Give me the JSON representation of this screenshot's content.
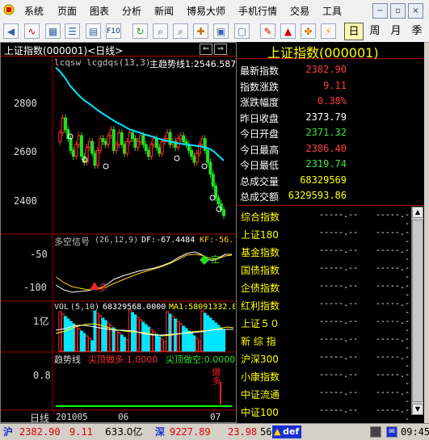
{
  "menu": {
    "items": [
      "系统",
      "页面",
      "图表",
      "分析",
      "新闻",
      "博易大师",
      "手机行情",
      "交易",
      "工具"
    ],
    "window_buttons": [
      "−",
      "▫",
      "×"
    ]
  },
  "toolbar": {
    "periods": [
      "日",
      "周",
      "月",
      "季"
    ],
    "active_period": "日"
  },
  "chart": {
    "title": "上证指数(000001)<日线>",
    "nav_arrows": [
      "⇐",
      "⇒"
    ],
    "main_indicator": {
      "label1": "lcqsw",
      "label2": "lcgdqs(13,3)",
      "label3": "主趋势线1:2546.587"
    },
    "y_ticks_main": [
      "2800",
      "2600",
      "2400"
    ],
    "macd": {
      "title": "多空信号",
      "params": "(26,12,9)",
      "df": "DF:-67.4484",
      "kf": "KF:-56.1",
      "y_ticks": [
        "-50",
        "-100"
      ],
      "buy_signal": "多",
      "sell_signal": "空"
    },
    "vol": {
      "title": "VOL",
      "params": "(5,10)",
      "value": "68329568.0000",
      "ma1": "MA1:58091332.8",
      "y_tick": "1亿"
    },
    "trend": {
      "title": "趋势线",
      "top_more": "尖顶做多:1.0000",
      "top_short": "尖顶做空:0.0000",
      "y_tick": "0.8",
      "signal": "做多"
    },
    "x_axis": {
      "period_label": "日线",
      "ticks": [
        "201005",
        "06",
        "07"
      ]
    },
    "chart_data": {
      "type": "candlestick",
      "title": "上证指数(000001)<日线>",
      "ylim": [
        2300,
        2900
      ],
      "y_ticks": [
        2800,
        2600,
        2400
      ],
      "x_ticks": [
        "201005",
        "06",
        "07"
      ],
      "trend_line_name": "主趋势线1",
      "trend_line_last": 2546.587,
      "trend_line": [
        2860,
        2845,
        2825,
        2800,
        2782,
        2765,
        2750,
        2740,
        2728,
        2716,
        2705,
        2695,
        2685,
        2675,
        2667,
        2658,
        2650,
        2645,
        2640,
        2634,
        2630,
        2625,
        2620,
        2615,
        2612,
        2608,
        2605,
        2602,
        2600,
        2598,
        2596,
        2594,
        2590,
        2585,
        2575,
        2560,
        2546
      ]
    }
  },
  "quote": {
    "title": "上证指数(000001)",
    "rows": [
      {
        "label": "最新指数",
        "value": "2382.90",
        "color": "red"
      },
      {
        "label": "指数涨跌",
        "value": "9.11",
        "color": "red"
      },
      {
        "label": "涨跌幅度",
        "value": "0.38%",
        "color": "red"
      },
      {
        "label": "昨日收盘",
        "value": "2373.79",
        "color": "white"
      },
      {
        "label": "今日开盘",
        "value": "2371.32",
        "color": "green"
      },
      {
        "label": "今日最高",
        "value": "2386.40",
        "color": "red"
      },
      {
        "label": "今日最低",
        "value": "2319.74",
        "color": "green"
      },
      {
        "label": "总成交量",
        "value": "68329569",
        "color": "yellow"
      },
      {
        "label": "总成交额",
        "value": "6329593.86",
        "color": "yellow"
      }
    ]
  },
  "index_list": [
    {
      "name": "综合指数",
      "v1": "-----.--",
      "v2": "-----.--"
    },
    {
      "name": "上证180",
      "v1": "-----.--",
      "v2": "-----.--"
    },
    {
      "name": "基金指数",
      "v1": "-----.--",
      "v2": "-----.--"
    },
    {
      "name": "国债指数",
      "v1": "-----.--",
      "v2": "-----.--"
    },
    {
      "name": "企债指数",
      "v1": "-----.--",
      "v2": "-----.--"
    },
    {
      "name": "红利指数",
      "v1": "-----.--",
      "v2": "-----.--"
    },
    {
      "name": "上证５０",
      "v1": "-----.--",
      "v2": "-----.--"
    },
    {
      "name": "新 综 指",
      "v1": "-----.--",
      "v2": "-----.--"
    },
    {
      "name": "沪深300",
      "v1": "-----.--",
      "v2": "-----.--"
    },
    {
      "name": "小康指数",
      "v1": "-----.--",
      "v2": "-----.--"
    },
    {
      "name": "中证流通",
      "v1": "-----.--",
      "v2": "-----.--"
    },
    {
      "name": "中证100",
      "v1": "-----.--",
      "v2": "-----.--"
    }
  ],
  "statusbar": {
    "sh_label": "沪",
    "sh_value": "2382.90",
    "sh_change": "9.11",
    "sh_amount": "633.0亿",
    "sz_label": "深",
    "sz_value": "9227.89",
    "sz_change": "23.98",
    "sz_count": "56",
    "def": "def",
    "time": "09:45"
  }
}
